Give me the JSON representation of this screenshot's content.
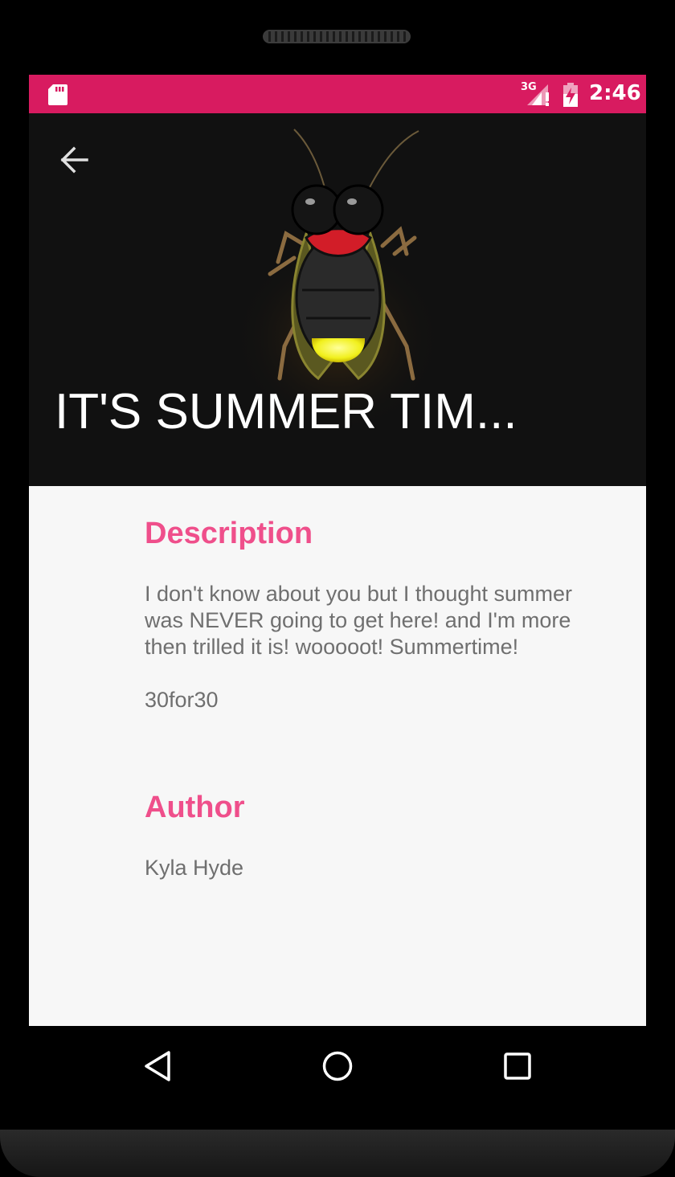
{
  "statusbar": {
    "time": "2:46",
    "network_label": "3G",
    "icons": [
      "sd-card-icon",
      "signal-3g-icon",
      "battery-charging-icon"
    ],
    "color": "#d81b60"
  },
  "header": {
    "title": "IT'S SUMMER TIM...",
    "back_icon": "arrow-back-icon"
  },
  "sections": {
    "description": {
      "heading": "Description",
      "body": "I don't know about you but I thought summer was NEVER going to get here! and I'm more then trilled it is! wooooot! Summertime!",
      "tag": "30for30"
    },
    "author": {
      "heading": "Author",
      "name": "Kyla Hyde"
    }
  },
  "navbar": {
    "icons": [
      "back-triangle-icon",
      "home-circle-icon",
      "recents-square-icon"
    ]
  },
  "colors": {
    "accent": "#ef4f8b",
    "status_bar": "#d81b60",
    "header_bg": "#111111",
    "body_text": "#6f6f6f"
  }
}
